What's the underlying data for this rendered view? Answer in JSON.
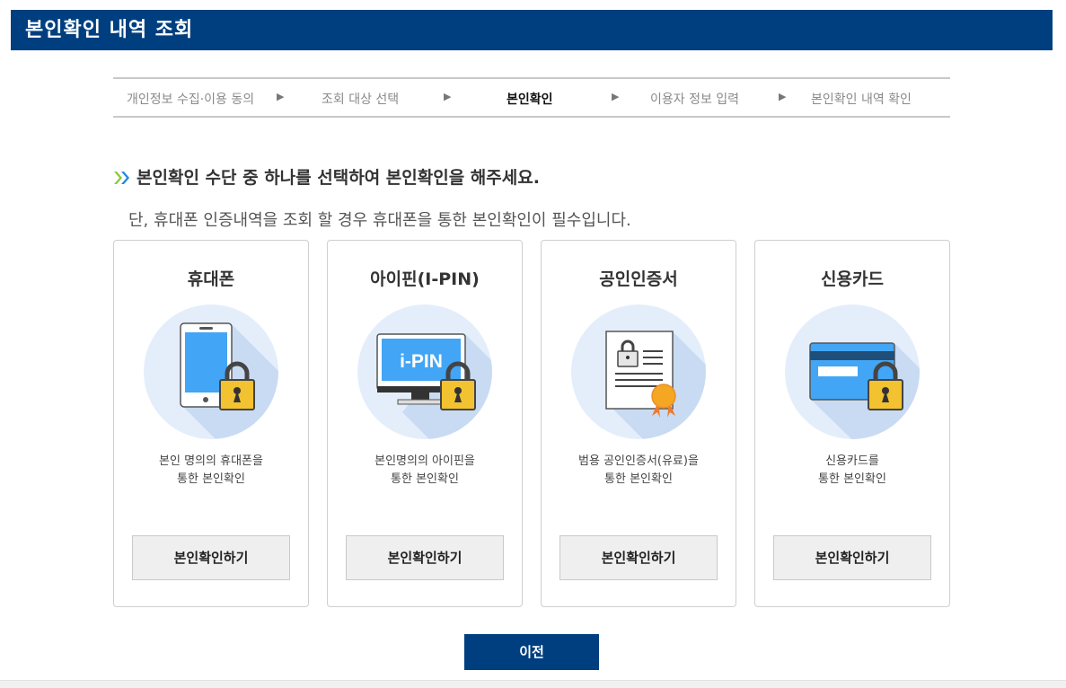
{
  "header": {
    "title": "본인확인 내역 조회"
  },
  "steps": [
    {
      "label": "개인정보 수집·이용 동의",
      "active": false
    },
    {
      "label": "조회 대상 선택",
      "active": false
    },
    {
      "label": "본인확인",
      "active": true
    },
    {
      "label": "이용자 정보 입력",
      "active": false
    },
    {
      "label": "본인확인 내역 확인",
      "active": false
    }
  ],
  "step_arrow_glyph": "▶",
  "guide": {
    "title": "본인확인 수단 중 하나를 선택하여 본인확인을 해주세요.",
    "subtitle": "단, 휴대폰 인증내역을 조회 할 경우 휴대폰을 통한 본인확인이 필수입니다."
  },
  "methods": [
    {
      "title": "휴대폰",
      "icon": "phone-lock-icon",
      "desc_line1": "본인 명의의 휴대폰을",
      "desc_line2": "통한 본인확인",
      "button": "본인확인하기"
    },
    {
      "title": "아이핀(I-PIN)",
      "icon": "ipin-monitor-lock-icon",
      "icon_text": "i-PIN",
      "desc_line1": "본인명의의 아이핀을",
      "desc_line2": "통한 본인확인",
      "button": "본인확인하기"
    },
    {
      "title": "공인인증서",
      "icon": "certificate-icon",
      "desc_line1": "범용 공인인증서(유료)을",
      "desc_line2": "통한 본인확인",
      "button": "본인확인하기"
    },
    {
      "title": "신용카드",
      "icon": "credit-card-lock-icon",
      "desc_line1": "신용카드를",
      "desc_line2": "통한 본인확인",
      "button": "본인확인하기"
    }
  ],
  "prev_button": "이전",
  "colors": {
    "primary": "#003f7f",
    "icon_circle": "#e4eefb",
    "icon_blue": "#42a5f5",
    "lock_yellow": "#f2c230",
    "medal_orange": "#f5a623"
  }
}
